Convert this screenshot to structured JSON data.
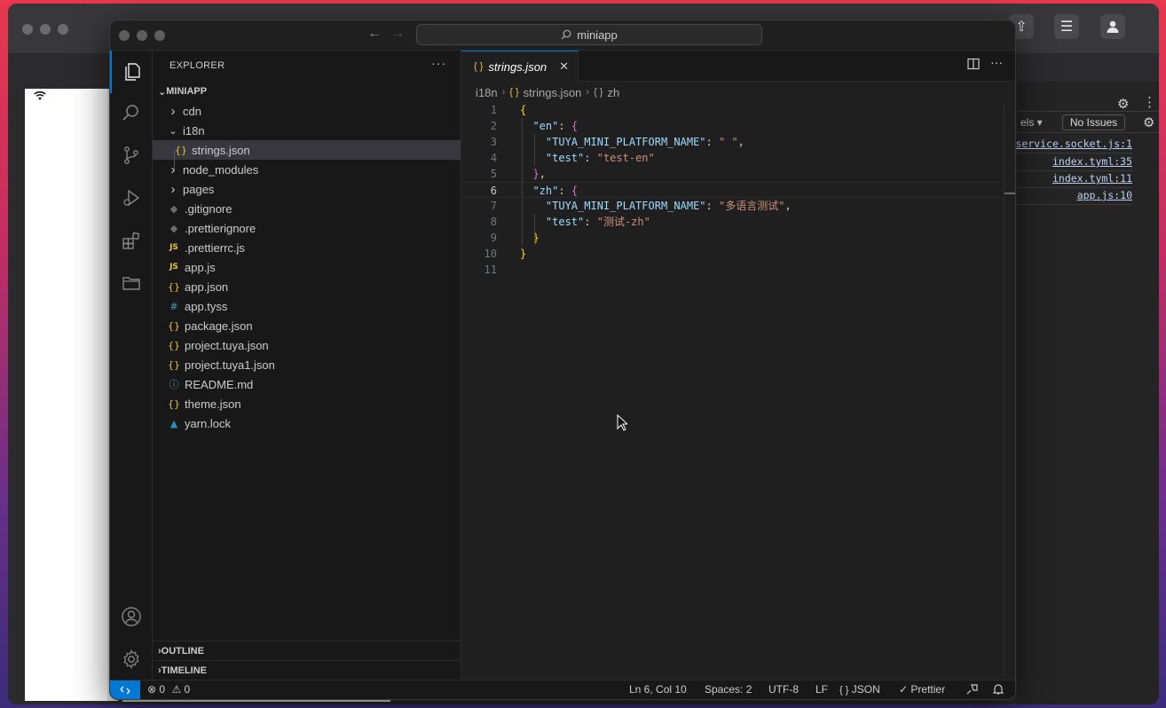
{
  "window": {
    "command_center": "miniapp"
  },
  "devtools": {
    "filter_label": "els ▾",
    "no_issues": "No Issues",
    "links": [
      "service.socket.js:1",
      "index.tyml:35",
      "index.tyml:11",
      "app.js:10"
    ]
  },
  "explorer": {
    "title": "EXPLORER",
    "more": "···",
    "folder": "MINIAPP",
    "items": [
      {
        "name": "cdn",
        "kind": "folder",
        "expanded": false,
        "depth": 0
      },
      {
        "name": "i18n",
        "kind": "folder",
        "expanded": true,
        "depth": 0
      },
      {
        "name": "strings.json",
        "kind": "json",
        "depth": 1,
        "selected": true
      },
      {
        "name": "node_modules",
        "kind": "folder",
        "expanded": false,
        "depth": 0
      },
      {
        "name": "pages",
        "kind": "folder",
        "expanded": false,
        "depth": 0
      },
      {
        "name": ".gitignore",
        "kind": "git",
        "depth": 0
      },
      {
        "name": ".prettierignore",
        "kind": "git",
        "depth": 0
      },
      {
        "name": ".prettierrc.js",
        "kind": "js",
        "depth": 0
      },
      {
        "name": "app.js",
        "kind": "js",
        "depth": 0
      },
      {
        "name": "app.json",
        "kind": "json",
        "depth": 0
      },
      {
        "name": "app.tyss",
        "kind": "css",
        "depth": 0
      },
      {
        "name": "package.json",
        "kind": "json",
        "depth": 0
      },
      {
        "name": "project.tuya.json",
        "kind": "json",
        "depth": 0
      },
      {
        "name": "project.tuya1.json",
        "kind": "json",
        "depth": 0
      },
      {
        "name": "README.md",
        "kind": "info",
        "depth": 0
      },
      {
        "name": "theme.json",
        "kind": "json",
        "depth": 0
      },
      {
        "name": "yarn.lock",
        "kind": "yarn",
        "depth": 0
      }
    ],
    "outline": "OUTLINE",
    "timeline": "TIMELINE"
  },
  "editor": {
    "tab_label": "strings.json",
    "tab_icon": "{ }",
    "breadcrumb": [
      "i18n",
      "strings.json",
      "zh"
    ],
    "current_line": 6,
    "lines": [
      "{",
      "  \"en\": {",
      "    \"TUYA_MINI_PLATFORM_NAME\": \" \",",
      "    \"test\": \"test-en\"",
      "  },",
      "  \"zh\": {",
      "    \"TUYA_MINI_PLATFORM_NAME\": \"多语言测试\",",
      "    \"test\": \"测试-zh\"",
      "  }",
      "}",
      ""
    ]
  },
  "status": {
    "errors": "0",
    "warnings": "0",
    "position": "Ln 6, Col 10",
    "spaces": "Spaces: 2",
    "encoding": "UTF-8",
    "eol": "LF",
    "language": "JSON",
    "language_icon": "{ }",
    "formatter": "Prettier"
  },
  "colors": {
    "accent": "#0078d4",
    "json_icon": "#e8c33d",
    "js_icon": "#e8c33d",
    "string": "#ce9178",
    "key": "#9cdcfe"
  }
}
